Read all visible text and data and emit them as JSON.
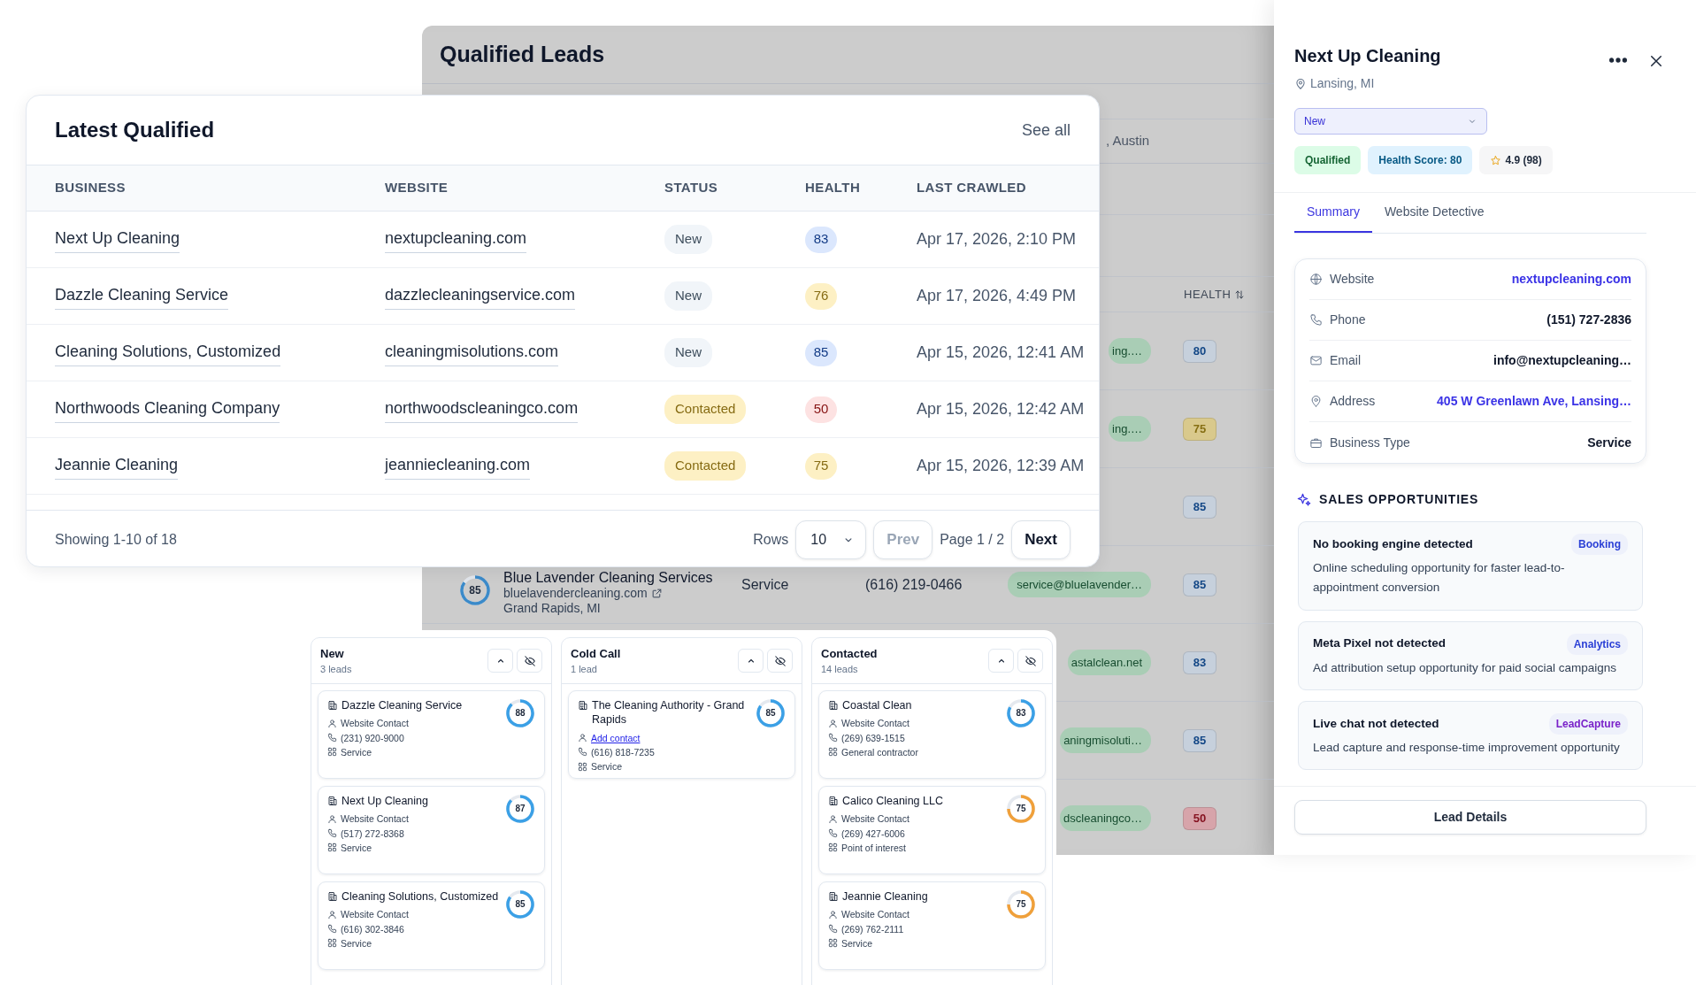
{
  "background_panel": {
    "title": "Qualified Leads",
    "filter_text": ", Austin",
    "health_header": "HEALTH",
    "rows": [
      {
        "email": "ing.…",
        "health": "80",
        "color": "#c6d0dc"
      },
      {
        "email": "ing.…",
        "health": "75",
        "color": "#d9c98c"
      },
      {
        "health": "85",
        "color": "#c6d0dc"
      },
      {
        "score": "85",
        "level": 0.85,
        "name": "Blue Lavender Cleaning Services",
        "website": "bluelavendercleaning.com",
        "location": "Grand Rapids, MI",
        "type": "Service",
        "phone": "(616) 219-0466",
        "email": "service@bluelavender…",
        "health": "85",
        "color": "#c6d0dc"
      },
      {
        "email": "astalclean.net",
        "health": "83",
        "color": "#c6d0dc"
      },
      {
        "email": "aningmisoluti…",
        "health": "85",
        "color": "#c6d0dc"
      },
      {
        "email": "dscleaningco…",
        "health": "50",
        "color": "#d7a4aa"
      }
    ]
  },
  "latest": {
    "title": "Latest Qualified",
    "see_all": "See all",
    "columns": [
      "BUSINESS",
      "WEBSITE",
      "STATUS",
      "HEALTH",
      "LAST CRAWLED"
    ],
    "rows": [
      {
        "business": "Next Up Cleaning",
        "website": "nextupcleaning.com",
        "status": {
          "label": "New",
          "color": "#f1f5f9"
        },
        "health": {
          "value": "83",
          "color": "#dbe7fd"
        },
        "last_crawled": "Apr 17, 2026, 2:10 PM"
      },
      {
        "business": "Dazzle Cleaning Service",
        "website": "dazzlecleaningservice.com",
        "status": {
          "label": "New",
          "color": "#f1f5f9"
        },
        "health": {
          "value": "76",
          "color": "#fdf0c4"
        },
        "last_crawled": "Apr 17, 2026, 4:49 PM"
      },
      {
        "business": "Cleaning Solutions, Customized",
        "website": "cleaningmisolutions.com",
        "status": {
          "label": "New",
          "color": "#f1f5f9"
        },
        "health": {
          "value": "85",
          "color": "#dbe7fd"
        },
        "last_crawled": "Apr 15, 2026, 12:41 AM"
      },
      {
        "business": "Northwoods Cleaning Company",
        "website": "northwoodscleaningco.com",
        "status": {
          "label": "Contacted",
          "color": "#fdf0c4"
        },
        "health": {
          "value": "50",
          "color": "#fde2e2"
        },
        "last_crawled": "Apr 15, 2026, 12:42 AM"
      },
      {
        "business": "Jeannie Cleaning",
        "website": "jeanniecleaning.com",
        "status": {
          "label": "Contacted",
          "color": "#fdf0c4"
        },
        "health": {
          "value": "75",
          "color": "#fdf0c4"
        },
        "last_crawled": "Apr 15, 2026, 12:39 AM"
      }
    ],
    "showing": "Showing 1-10 of 18",
    "rows_label": "Rows",
    "rows_value": "10",
    "prev": "Prev",
    "prev_disabled": true,
    "page": "Page 1 / 2",
    "next": "Next"
  },
  "kanban": {
    "columns": [
      {
        "title": "New",
        "count": "3 leads",
        "cards": [
          {
            "name": "Dazzle Cleaning Service",
            "contact": {
              "text": "Website Contact",
              "kind": "text"
            },
            "phone": "(231) 920-9000",
            "type": "Service",
            "score": "88",
            "level": 0.88,
            "color": "#3ba0e6"
          },
          {
            "name": "Next Up Cleaning",
            "contact": {
              "text": "Website Contact",
              "kind": "text"
            },
            "phone": "(517) 272-8368",
            "type": "Service",
            "score": "87",
            "level": 0.87,
            "color": "#3ba0e6"
          },
          {
            "name": "Cleaning Solutions, Customized",
            "contact": {
              "text": "Website Contact",
              "kind": "text"
            },
            "phone": "(616) 302-3846",
            "type": "Service",
            "score": "85",
            "level": 0.85,
            "color": "#3ba0e6"
          }
        ]
      },
      {
        "title": "Cold Call",
        "count": "1 lead",
        "cards": [
          {
            "name": "The Cleaning Authority - Grand Rapids",
            "contact": {
              "text": "Add contact",
              "kind": "link"
            },
            "phone": "(616) 818-7235",
            "type": "Service",
            "score": "85",
            "level": 0.85,
            "color": "#3ba0e6"
          }
        ]
      },
      {
        "title": "Contacted",
        "count": "14 leads",
        "cards": [
          {
            "name": "Coastal Clean",
            "contact": {
              "text": "Website Contact",
              "kind": "text"
            },
            "phone": "(269) 639-1515",
            "type": "General contractor",
            "score": "83",
            "level": 0.83,
            "color": "#3ba0e6"
          },
          {
            "name": "Calico Cleaning LLC",
            "contact": {
              "text": "Website Contact",
              "kind": "text"
            },
            "phone": "(269) 427-6006",
            "type": "Point of interest",
            "score": "75",
            "level": 0.75,
            "color": "#f0a03a"
          },
          {
            "name": "Jeannie Cleaning",
            "contact": {
              "text": "Website Contact",
              "kind": "text"
            },
            "phone": "(269) 762-2111",
            "type": "Service",
            "score": "75",
            "level": 0.75,
            "color": "#f0a03a"
          }
        ]
      }
    ]
  },
  "lead_panel": {
    "title": "Next Up Cleaning",
    "location": "Lansing, MI",
    "status": "New",
    "tags": [
      {
        "label": "Qualified",
        "kind": "success"
      },
      {
        "label": "Health Score: 80",
        "kind": "info"
      },
      {
        "label": "4.9 (98)",
        "kind": "rating"
      }
    ],
    "tabs": [
      {
        "label": "Summary",
        "selected": true
      },
      {
        "label": "Website Detective",
        "selected": false
      }
    ],
    "details": [
      {
        "label": "Website",
        "value": "nextupcleaning.com",
        "kind": "link"
      },
      {
        "label": "Phone",
        "value": "(151) 727-2836",
        "kind": "text"
      },
      {
        "label": "Email",
        "value": "info@nextupcleaning…",
        "kind": "text"
      },
      {
        "label": "Address",
        "value": "405 W Greenlawn Ave, Lansing…",
        "kind": "link"
      },
      {
        "label": "Business Type",
        "value": "Service",
        "kind": "text"
      }
    ],
    "section_title": "SALES OPPORTUNITIES",
    "opportunities": [
      {
        "title": "No booking engine detected",
        "tag": "Booking",
        "color": "#2a3fd6",
        "description": "Online scheduling opportunity for faster lead-to-appointment conversion"
      },
      {
        "title": "Meta Pixel not detected",
        "tag": "Analytics",
        "color": "#2a3fd6",
        "description": "Ad attribution setup opportunity for paid social campaigns"
      },
      {
        "title": "Live chat not detected",
        "tag": "LeadCapture",
        "color": "#7a22c9",
        "description": "Lead capture and response-time improvement opportunity"
      }
    ],
    "button": "Lead Details"
  }
}
